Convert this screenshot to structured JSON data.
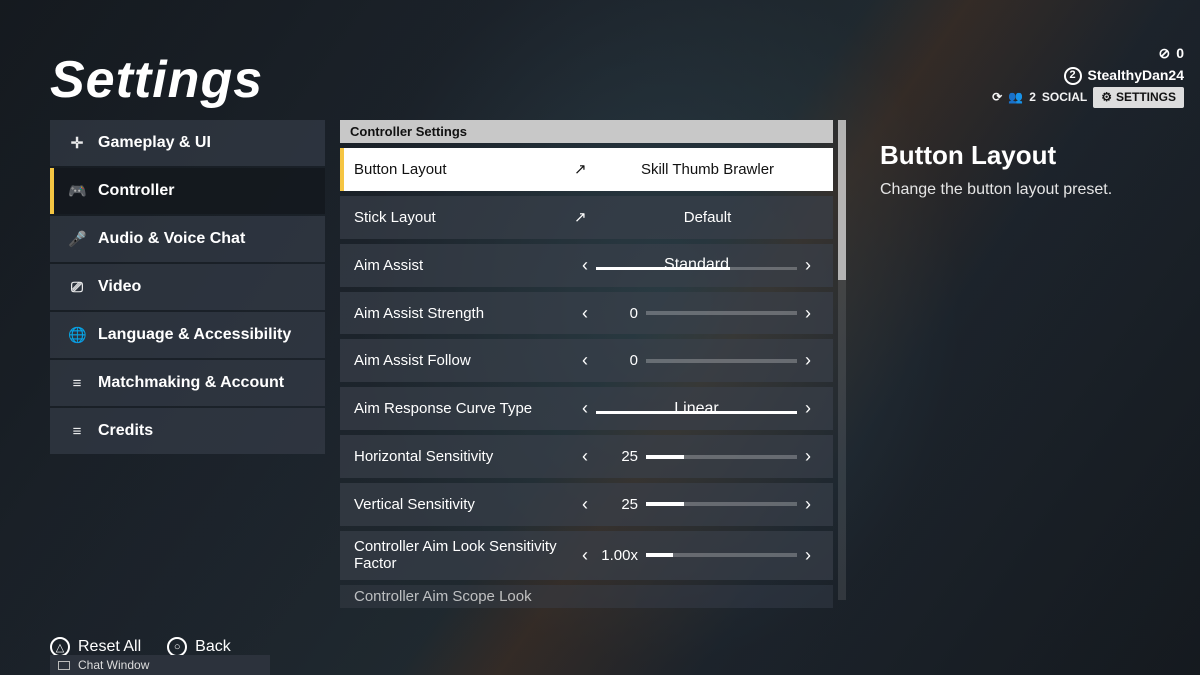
{
  "title": "Settings",
  "sidebar": {
    "items": [
      {
        "icon": "crosshair",
        "label": "Gameplay & UI"
      },
      {
        "icon": "gamepad",
        "label": "Controller"
      },
      {
        "icon": "mic",
        "label": "Audio & Voice Chat"
      },
      {
        "icon": "monitor",
        "label": "Video"
      },
      {
        "icon": "globe",
        "label": "Language & Accessibility"
      },
      {
        "icon": "list",
        "label": "Matchmaking & Account"
      },
      {
        "icon": "list",
        "label": "Credits"
      }
    ],
    "active_index": 1
  },
  "section_header": "Controller Settings",
  "settings": [
    {
      "kind": "link",
      "label": "Button Layout",
      "value": "Skill Thumb Brawler",
      "selected": true
    },
    {
      "kind": "link",
      "label": "Stick Layout",
      "value": "Default"
    },
    {
      "kind": "option",
      "label": "Aim Assist",
      "value": "Standard",
      "option_index": 1,
      "option_count": 3
    },
    {
      "kind": "slider",
      "label": "Aim Assist Strength",
      "value": "0",
      "fill_pct": 0
    },
    {
      "kind": "slider",
      "label": "Aim Assist Follow",
      "value": "0",
      "fill_pct": 0
    },
    {
      "kind": "option",
      "label": "Aim Response Curve Type",
      "value": "Linear",
      "option_index": 1,
      "option_count": 2
    },
    {
      "kind": "slider",
      "label": "Horizontal Sensitivity",
      "value": "25",
      "fill_pct": 25
    },
    {
      "kind": "slider",
      "label": "Vertical Sensitivity",
      "value": "25",
      "fill_pct": 25
    },
    {
      "kind": "slider",
      "label": "Controller Aim Look Sensitivity Factor",
      "value": "1.00x",
      "fill_pct": 18,
      "two_line": true
    },
    {
      "kind": "trunc",
      "label": "Controller Aim Scope Look"
    }
  ],
  "detail": {
    "title": "Button Layout",
    "desc": "Change the button layout preset."
  },
  "topright": {
    "currency": "0",
    "player_num": "2",
    "player_name": "StealthyDan24",
    "friends_count": "2",
    "social_label": "SOCIAL",
    "settings_label": "SETTINGS"
  },
  "footer": {
    "reset": "Reset All",
    "back": "Back",
    "chat": "Chat Window"
  },
  "icons": {
    "crosshair": "✛",
    "gamepad": "🎮",
    "mic": "🎤",
    "monitor": "⎚",
    "globe": "🌐",
    "list": "≡",
    "external": "↗",
    "chev_left": "‹",
    "chev_right": "›",
    "gear": "⚙",
    "triangle": "△",
    "circle": "○",
    "coin": "⊘",
    "clock": "⟳",
    "people": "👥"
  }
}
